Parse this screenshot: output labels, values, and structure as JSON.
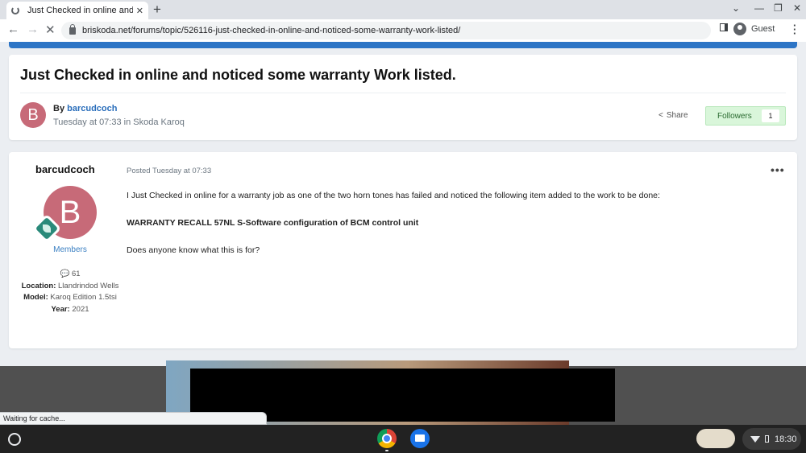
{
  "browser": {
    "tab_title": "Just Checked in online and notic",
    "new_tab": "+",
    "url": "briskoda.net/forums/topic/526116-just-checked-in-online-and-noticed-some-warranty-work-listed/",
    "profile_label": "Guest",
    "status_text": "Waiting for cache..."
  },
  "topic": {
    "title": "Just Checked in online and noticed some warranty Work listed.",
    "by_prefix": "By",
    "author": "barcudcoch",
    "avatar_letter": "B",
    "meta": "Tuesday at 07:33 in Skoda Karoq",
    "share_label": "Share",
    "followers_label": "Followers",
    "followers_count": "1"
  },
  "post": {
    "author": "barcudcoch",
    "avatar_letter": "B",
    "group": "Members",
    "post_count": "61",
    "location_label": "Location:",
    "location": "Llandrindod Wells",
    "model_label": "Model:",
    "model": "Karoq Edition 1.5tsi",
    "year_label": "Year:",
    "year": "2021",
    "date": "Posted Tuesday at 07:33",
    "menu": "•••",
    "body_1": "I Just Checked in online for a warranty job as one of the two horn tones has failed and noticed the following item added to the work to be done:",
    "body_2": "WARRANTY RECALL 57NL S-Software configuration of BCM control unit",
    "body_3": "Does anyone know what this is for?"
  },
  "system": {
    "clock": "18:30"
  },
  "colors": {
    "accent": "#2d75c6",
    "avatar": "#c76a78",
    "followers_bg": "#d9f6da",
    "badge": "#2a8a7a"
  }
}
